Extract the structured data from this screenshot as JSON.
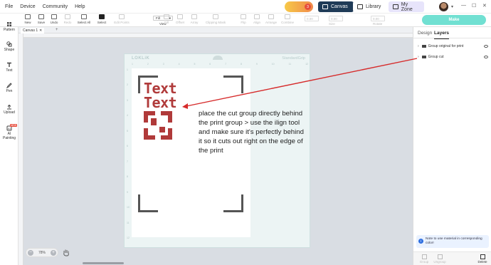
{
  "menu": [
    "File",
    "Device",
    "Community",
    "Help"
  ],
  "promo": {
    "badge": "3"
  },
  "nav": {
    "canvas": "Canvas",
    "library": "Library",
    "myzone": "My Zone"
  },
  "window_controls": {
    "minimize": "—",
    "maximize": "☐",
    "close": "✕"
  },
  "toolbar": {
    "tools": [
      {
        "label": "New",
        "state": "enabled"
      },
      {
        "label": "Save",
        "state": "enabled"
      },
      {
        "label": "Undo",
        "state": "enabled"
      },
      {
        "label": "Redo",
        "state": "disabled"
      },
      {
        "label": "Select All",
        "state": "enabled"
      },
      {
        "label": "Select",
        "state": "active"
      },
      {
        "label": "Edit Points",
        "state": "disabled"
      }
    ],
    "view_value": "Fill",
    "view_label": "View",
    "tools_right": [
      {
        "label": "Fill"
      },
      {
        "label": "Offset"
      },
      {
        "label": "Array"
      },
      {
        "label": "Clipping Mask"
      },
      {
        "label": "Flip"
      },
      {
        "label": "Align"
      },
      {
        "label": "Arrange"
      },
      {
        "label": "Combine"
      }
    ],
    "size_label": "Size",
    "rotate_label": "Rotate",
    "size_w": "0.00",
    "size_h": "0.00",
    "rotate_val": "0.00",
    "make_label": "Make"
  },
  "sidebar": [
    {
      "label": "Pattern",
      "icon": "pattern-icon"
    },
    {
      "label": "Shape",
      "icon": "shape-icon"
    },
    {
      "label": "Text",
      "icon": "text-icon"
    },
    {
      "label": "Pen",
      "icon": "pen-icon"
    },
    {
      "label": "Upload",
      "icon": "upload-icon"
    },
    {
      "label": "AI Painting",
      "icon": "ai-painting-icon",
      "badge": "NEW"
    }
  ],
  "canvas_tab": {
    "label": "Canvas 1",
    "close": "✕",
    "add": "+"
  },
  "mat": {
    "brand": "LOKLiK",
    "grip": "StandardGrip",
    "top_numbers": [
      "1",
      "2",
      "3",
      "4",
      "5",
      "6",
      "7",
      "8",
      "9",
      "10",
      "11",
      "12"
    ],
    "left_numbers": [
      "1",
      "2",
      "3",
      "4",
      "5",
      "6",
      "7",
      "8",
      "9",
      "10",
      "11",
      "12"
    ]
  },
  "design": {
    "text_line1": "Text",
    "text_line2": "Text",
    "accent_color": "#b03a3a"
  },
  "annotation": "place the cut group directly behind\nthe print group > use the ilign tool\nand make sure it's perfectly behind\nit so it cuts out right on the edge of\nthe print",
  "zoom": {
    "value": "78%",
    "minus": "−",
    "plus": "+"
  },
  "right_panel": {
    "tabs": [
      {
        "label": "Design",
        "active": false
      },
      {
        "label": "Layers",
        "active": true
      }
    ],
    "layers": [
      {
        "name": "Group original for print"
      },
      {
        "name": "Group cut"
      }
    ],
    "info": "Note to use material in corresponding color!",
    "bottom_buttons": [
      {
        "label": "Group",
        "state": "disabled"
      },
      {
        "label": "Ungroup",
        "state": "disabled"
      },
      {
        "label": "Delete",
        "state": "enabled"
      }
    ]
  },
  "colors": {
    "annotation_arrow": "#d62b2b",
    "canvas_nav_bg": "#1f3b57",
    "make_button": "#71e0d2"
  }
}
